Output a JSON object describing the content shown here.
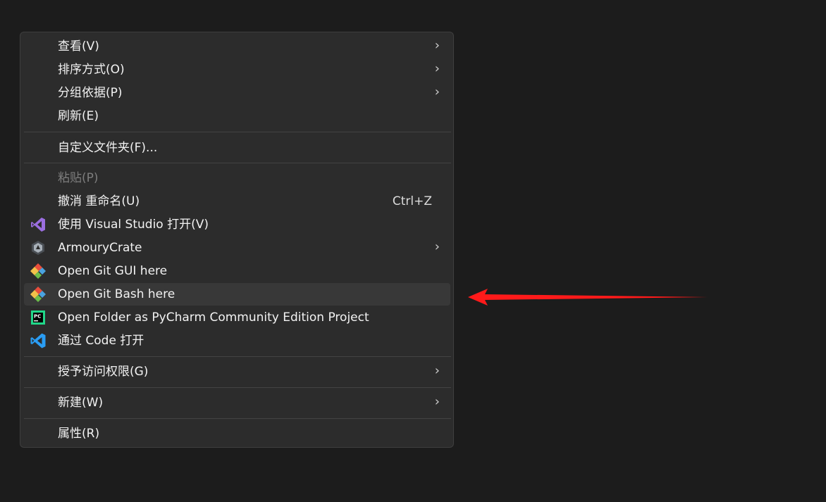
{
  "menu": {
    "items": [
      {
        "label": "查看(V)"
      },
      {
        "label": "排序方式(O)"
      },
      {
        "label": "分组依据(P)"
      },
      {
        "label": "刷新(E)"
      },
      {
        "label": "自定义文件夹(F)..."
      },
      {
        "label": "粘贴(P)",
        "state": "disabled"
      },
      {
        "label": "撤消 重命名(U)",
        "shortcut": "Ctrl+Z"
      },
      {
        "label": "使用 Visual Studio 打开(V)",
        "icon": "visual-studio-icon"
      },
      {
        "label": "ArmouryCrate",
        "icon": "armoury-crate-icon"
      },
      {
        "label": "Open Git GUI here",
        "icon": "git-icon"
      },
      {
        "label": "Open Git Bash here",
        "icon": "git-icon",
        "state": "hovered"
      },
      {
        "label": "Open Folder as PyCharm Community Edition Project",
        "icon": "pycharm-icon"
      },
      {
        "label": "通过 Code 打开",
        "icon": "vscode-icon"
      },
      {
        "label": "授予访问权限(G)"
      },
      {
        "label": "新建(W)"
      },
      {
        "label": "属性(R)"
      }
    ]
  },
  "annotation": {
    "color": "#ff1a1a",
    "target": "Open Git Bash here"
  },
  "colors": {
    "background": "#1c1c1c",
    "menu_bg": "#2c2c2c",
    "hover_bg": "#383838"
  }
}
